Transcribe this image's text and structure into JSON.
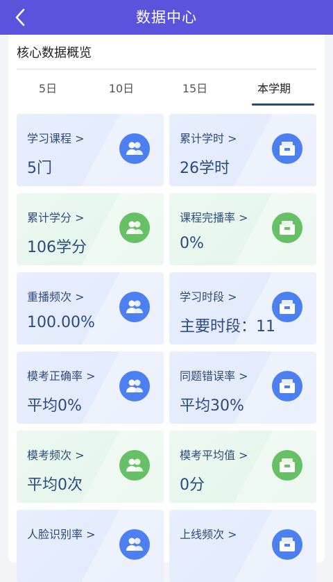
{
  "header": {
    "title": "数据中心"
  },
  "section": {
    "title": "核心数据概览"
  },
  "tabs": [
    {
      "label": "5日"
    },
    {
      "label": "10日"
    },
    {
      "label": "15日"
    },
    {
      "label": "本学期"
    }
  ],
  "tiles": [
    {
      "label": "学习课程 >",
      "value": "5门",
      "icon": "users-icon",
      "theme": "blue"
    },
    {
      "label": "累计学时 >",
      "value": "26学时",
      "icon": "calendar-icon",
      "theme": "blue"
    },
    {
      "label": "累计学分 >",
      "value": "106学分",
      "icon": "users-icon",
      "theme": "green"
    },
    {
      "label": "课程完播率 >",
      "value": "0%",
      "icon": "calendar-icon",
      "theme": "green"
    },
    {
      "label": "重播频次 >",
      "value": "100.00%",
      "icon": "users-icon",
      "theme": "blue"
    },
    {
      "label": "学习时段 >",
      "value": "主要时段：11",
      "icon": "calendar-icon",
      "theme": "blue"
    },
    {
      "label": "模考正确率 >",
      "value": "平均0%",
      "icon": "users-icon",
      "theme": "blue"
    },
    {
      "label": "同题错误率 >",
      "value": "平均30%",
      "icon": "calendar-icon",
      "theme": "blue"
    },
    {
      "label": "模考频次 >",
      "value": "平均0次",
      "icon": "users-icon",
      "theme": "green"
    },
    {
      "label": "模考平均值 >",
      "value": "0分",
      "icon": "calendar-icon",
      "theme": "green"
    },
    {
      "label": "人脸识别率 >",
      "value": "",
      "icon": "users-icon",
      "theme": "blue"
    },
    {
      "label": "上线频次 >",
      "value": "",
      "icon": "calendar-icon",
      "theme": "blue"
    }
  ]
}
